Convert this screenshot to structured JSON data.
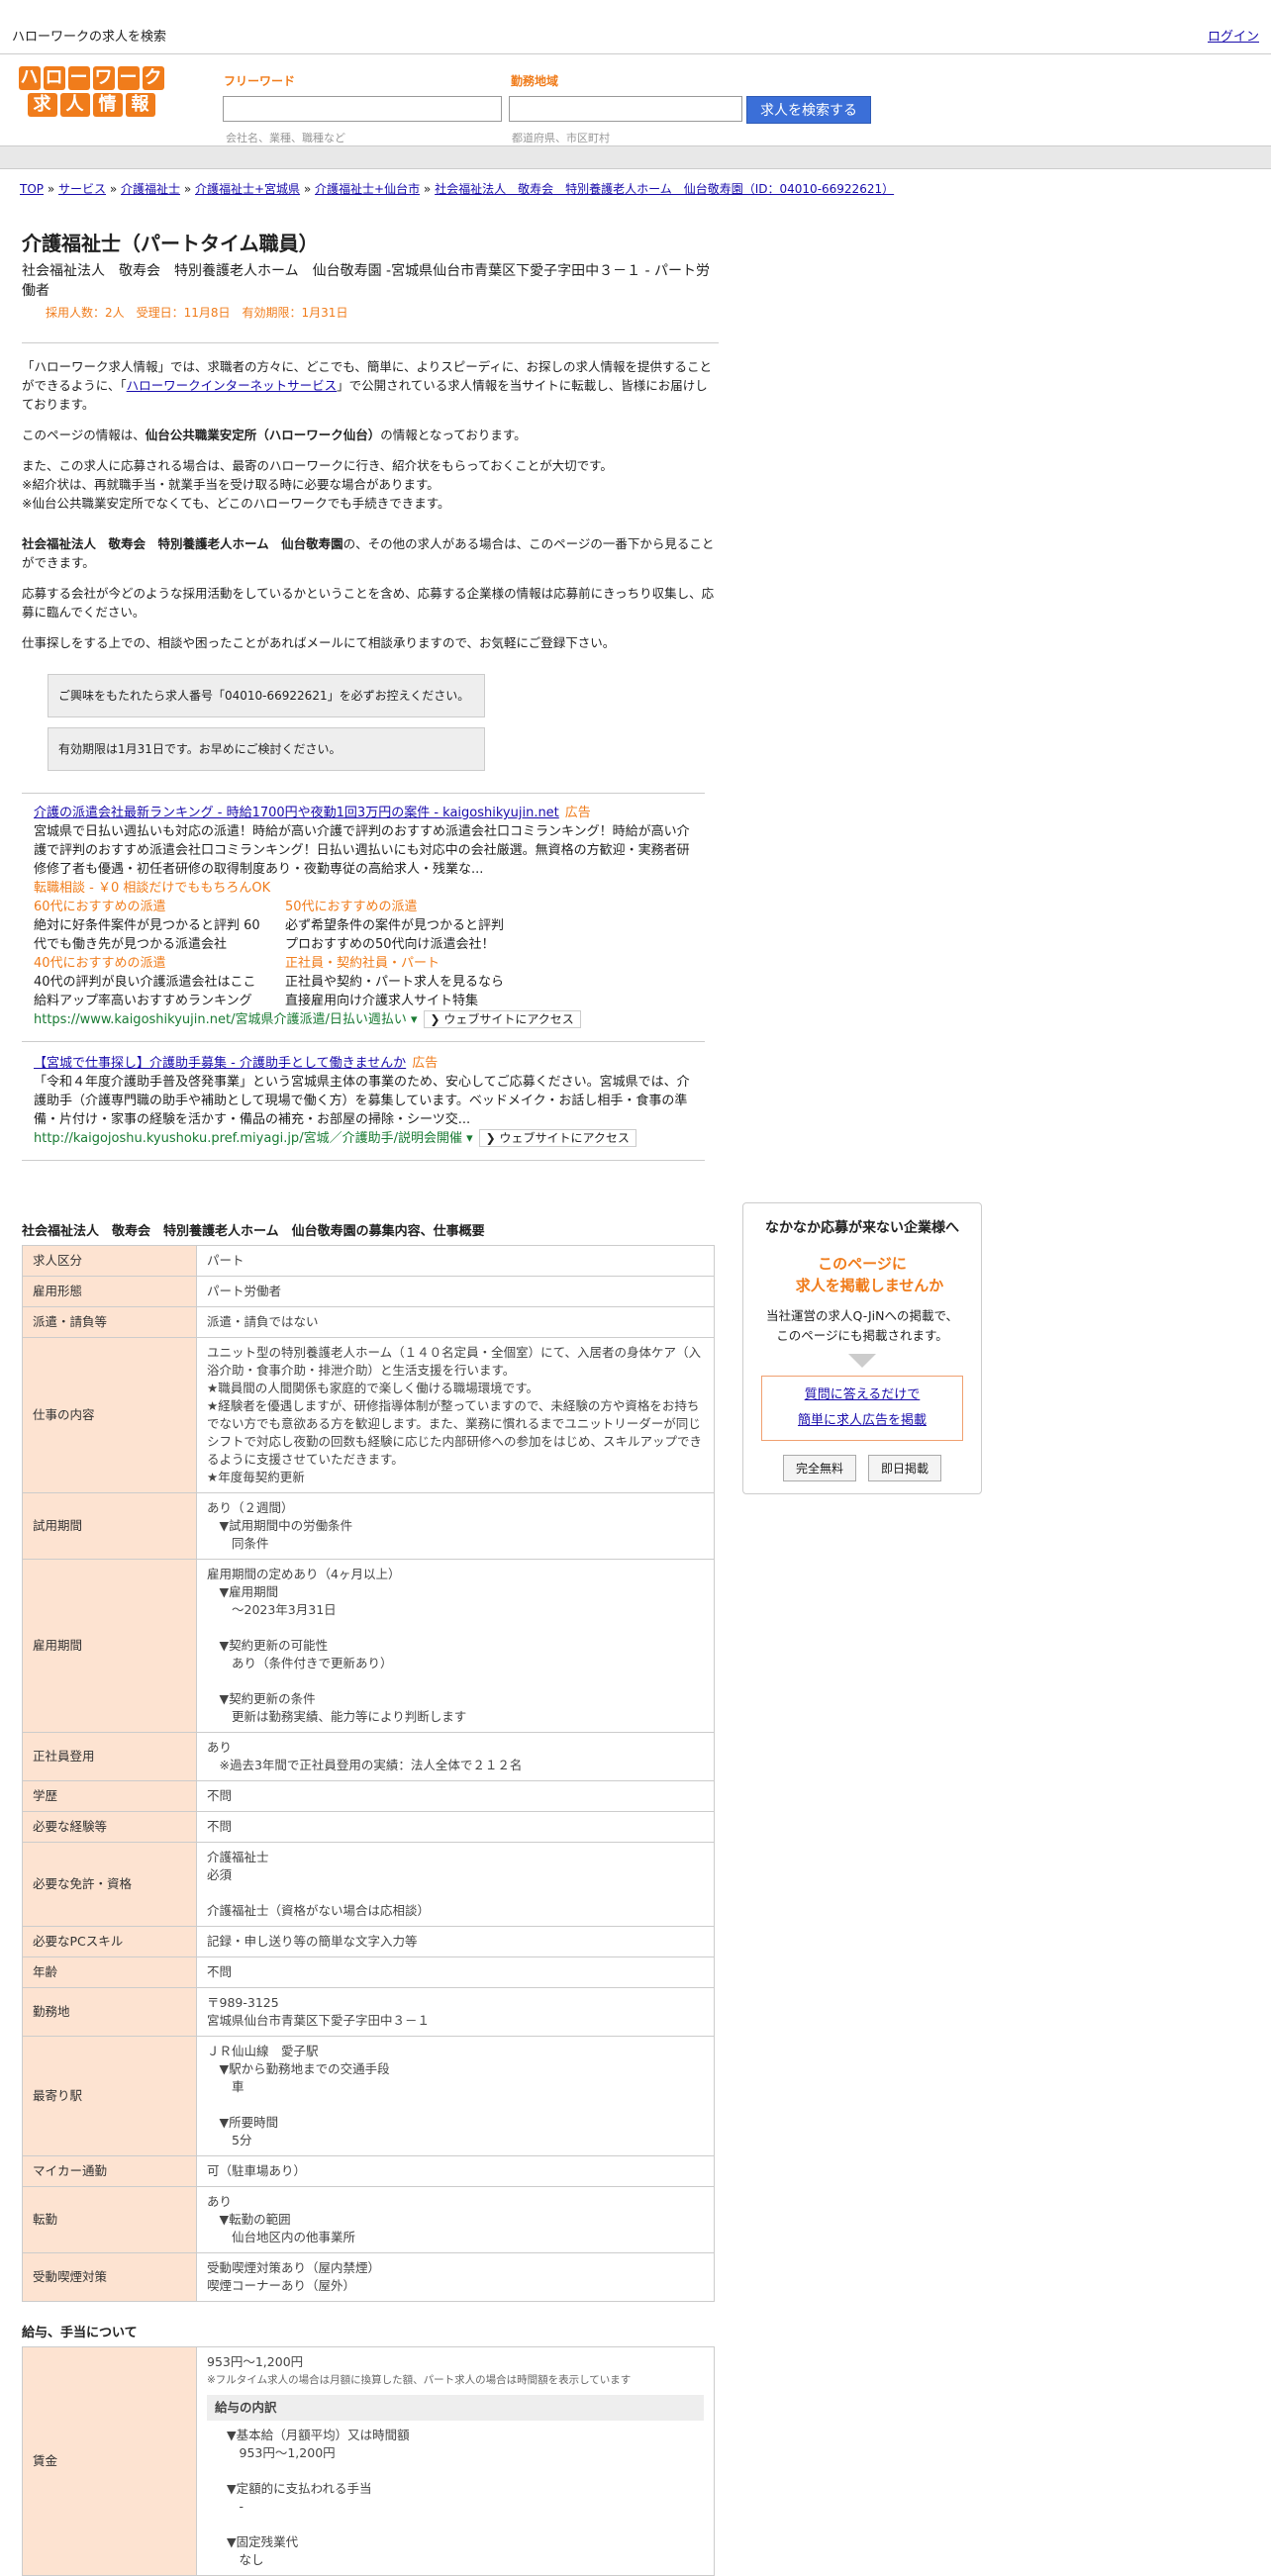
{
  "topbar": {
    "title": "ハローワークの求人を検索",
    "login": "ログイン"
  },
  "logo": {
    "row1": [
      "ハ",
      "ロ",
      "ー",
      "ワ",
      "ー",
      "ク"
    ],
    "row2": [
      "求",
      "人",
      "情",
      "報"
    ]
  },
  "search": {
    "keyword_label": "フリーワード",
    "keyword_hint": "会社名、業種、職種など",
    "area_label": "勤務地域",
    "area_hint": "都道府県、市区町村",
    "button": "求人を検索する"
  },
  "breadcrumb": [
    "TOP",
    "サービス",
    "介護福祉士",
    "介護福祉士+宮城県",
    "介護福祉士+仙台市",
    "社会福祉法人　敬寿会　特別養護老人ホーム　仙台敬寿園（ID：04010-66922621）"
  ],
  "job": {
    "title": "介護福祉士（パートタイム職員）",
    "subtitle": "社会福祉法人　敬寿会　特別養護老人ホーム　仙台敬寿園 -宮城県仙台市青葉区下愛子字田中３－１ - パート労働者",
    "meta": "採用人数：2人　受理日：11月8日　有効期限：1月31日"
  },
  "intro": {
    "p1a": "「ハローワーク求人情報」では、求職者の方々に、どこでも、簡単に、よりスピーディに、お探しの求人情報を提供することができるように、「",
    "p1link": "ハローワークインターネットサービス",
    "p1b": "」で公開されている求人情報を当サイトに転載し、皆様にお届けしております。",
    "p2a": "このページの情報は、",
    "p2b": "仙台公共職業安定所（ハローワーク仙台）",
    "p2c": "の情報となっております。",
    "p3": "また、この求人に応募される場合は、最寄のハローワークに行き、紹介状をもらっておくことが大切です。",
    "p3b": "※紹介状は、再就職手当・就業手当を受け取る時に必要な場合があります。",
    "p3c": "※仙台公共職業安定所でなくても、どこのハローワークでも手続きできます。",
    "p4a": "社会福祉法人　敬寿会　特別養護老人ホーム　仙台敬寿園",
    "p4b": "の、その他の求人がある場合は、このページの一番下から見ることができます。",
    "p5": "応募する会社が今どのような採用活動をしているかということを含め、応募する企業様の情報は応募前にきっちり収集し、応募に臨んでください。",
    "p6": "仕事探しをする上での、相談や困ったことがあればメールにて相談承りますので、お気軽にご登録下さい。"
  },
  "notices": [
    "ご興味をもたれたら求人番号「04010-66922621」を必ずお控えください。",
    "有効期限は1月31日です。お早めにご検討ください。"
  ],
  "ads": [
    {
      "title": "介護の派遣会社最新ランキング - 時給1700円や夜勤1回3万円の案件 - kaigoshikyujin.net",
      "tag": "広告",
      "desc": "宮城県で日払い週払いも対応の派遣！時給が高い介護で評判のおすすめ派遣会社口コミランキング！時給が高い介護で評判のおすすめ派遣会社口コミランキング！日払い週払いにも対応中の会社厳選。無資格の方歓迎・実務者研修修了者も優遇・初任者研修の取得制度あり・夜勤専従の高給求人・残業な...",
      "sub": "転職相談 - ￥0 相談だけでももちろんOK",
      "grid": [
        {
          "h": "60代におすすめの派遣",
          "t": "絶対に好条件案件が見つかると評判 60代でも働き先が見つかる派遣会社"
        },
        {
          "h": "50代におすすめの派遣",
          "t": "必ず希望条件の案件が見つかると評判 プロおすすめの50代向け派遣会社！"
        },
        {
          "h": "40代におすすめの派遣",
          "t": "40代の評判が良い介護派遣会社はここ 給料アップ率高いおすすめランキング"
        },
        {
          "h": "正社員・契約社員・パート",
          "t": "正社員や契約・パート求人を見るなら 直接雇用向け介護求人サイト特集"
        }
      ],
      "url": "https://www.kaigoshikyujin.net/宮城県介護派遣/日払い週払い ▾",
      "access": "❯ ウェブサイトにアクセス"
    },
    {
      "title": "【宮城で仕事探し】介護助手募集 - 介護助手として働きませんか",
      "tag": "広告",
      "desc": "「令和４年度介護助手普及啓発事業」という宮城県主体の事業のため、安心してご応募ください。宮城県では、介護助手（介護専門職の助手や補助として現場で働く方）を募集しています。ベッドメイク・お話し相手・食事の準備・片付け・家事の経験を活かす・備品の補充・お部屋の掃除・シーツ交...",
      "sub": "",
      "grid": [],
      "url": "http://kaigojoshu.kyushoku.pref.miyagi.jp/宮城／介護助手/説明会開催 ▾",
      "access": "❯ ウェブサイトにアクセス"
    }
  ],
  "details_title": "社会福祉法人　敬寿会　特別養護老人ホーム　仙台敬寿園の募集内容、仕事概要",
  "details": [
    {
      "h": "求人区分",
      "v": "パート"
    },
    {
      "h": "雇用形態",
      "v": "パート労働者"
    },
    {
      "h": "派遣・請負等",
      "v": "派遣・請負ではない"
    },
    {
      "h": "仕事の内容",
      "v": "ユニット型の特別養護老人ホーム（１４０名定員・全個室）にて、入居者の身体ケア（入浴介助・食事介助・排泄介助）と生活支援を行います。\n★職員間の人間関係も家庭的で楽しく働ける職場環境です。\n★経験者を優遇しますが、研修指導体制が整っていますので、未経験の方や資格をお持ちでない方でも意欲ある方を歓迎します。また、業務に慣れるまでユニットリーダーが同じシフトで対応し夜勤の回数も経験に応じた内部研修への参加をはじめ、スキルアップできるように支援させていただきます。\n★年度毎契約更新"
    },
    {
      "h": "試用期間",
      "v": "あり（２週間）\n　▼試用期間中の労働条件\n　　同条件"
    },
    {
      "h": "雇用期間",
      "v": "雇用期間の定めあり（4ヶ月以上）\n　▼雇用期間\n　　〜2023年3月31日\n\n　▼契約更新の可能性\n　　あり（条件付きで更新あり）\n\n　▼契約更新の条件\n　　更新は勤務実績、能力等により判断します"
    },
    {
      "h": "正社員登用",
      "v": "あり\n　※過去3年間で正社員登用の実績：法人全体で２１２名"
    },
    {
      "h": "学歴",
      "v": "不問"
    },
    {
      "h": "必要な経験等",
      "v": "不問"
    },
    {
      "h": "必要な免許・資格",
      "v": "介護福祉士\n必須\n\n介護福祉士（資格がない場合は応相談）"
    },
    {
      "h": "必要なPCスキル",
      "v": "記録・申し送り等の簡単な文字入力等"
    },
    {
      "h": "年齢",
      "v": "不問"
    },
    {
      "h": "勤務地",
      "v": "〒989-3125\n宮城県仙台市青葉区下愛子字田中３－１"
    },
    {
      "h": "最寄り駅",
      "v": "ＪＲ仙山線　愛子駅\n　▼駅から勤務地までの交通手段\n　　車\n\n　▼所要時間\n　　5分"
    },
    {
      "h": "マイカー通勤",
      "v": "可（駐車場あり）"
    },
    {
      "h": "転勤",
      "v": "あり\n　▼転勤の範囲\n　　仙台地区内の他事業所"
    },
    {
      "h": "受動喫煙対策",
      "v": "受動喫煙対策あり（屋内禁煙）\n喫煙コーナーあり（屋外）"
    }
  ],
  "salary_title": "給与、手当について",
  "salary": {
    "h": "賃金",
    "range": "953円〜1,200円",
    "note": "※フルタイム求人の場合は月額に換算した額、パート求人の場合は時間額を表示しています",
    "inner_hdr": "給与の内訳",
    "lines": "▼基本給（月額平均）又は時間額\n　953円〜1,200円\n\n▼定額的に支払われる手当\n　-\n\n▼固定残業代\n　なし"
  },
  "sidebox": {
    "title": "なかなか応募が来ない企業様へ",
    "red": "このページに\n　求人を掲載しませんか",
    "desc": "当社運営の求人Q-JiNへの掲載で、\nこのページにも掲載されます。",
    "link1": "質問に答えるだけで",
    "link2": "簡単に求人広告を掲載",
    "btn1": "完全無料",
    "btn2": "即日掲載"
  },
  "colors": {
    "accent": "#f07c1b",
    "header_cell": "#fde3d1",
    "search_button": "#3b6fd8"
  }
}
